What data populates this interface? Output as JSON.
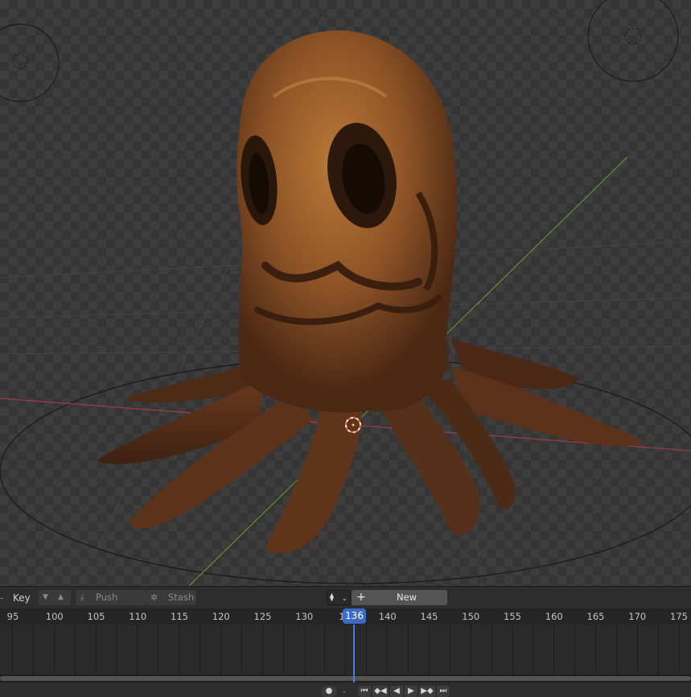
{
  "header": {
    "key_label": "Key",
    "push_down_label": "Push Down",
    "stash_label": "Stash",
    "new_label": "New",
    "plus_symbol": "+"
  },
  "timeline": {
    "current_frame": "136",
    "ticks": [
      "95",
      "100",
      "105",
      "110",
      "115",
      "120",
      "125",
      "130",
      "1",
      "140",
      "145",
      "150",
      "155",
      "160",
      "165",
      "170",
      "175"
    ]
  },
  "colors": {
    "x_axis": "#a23a45",
    "y_axis": "#5f8a30",
    "playhead": "#4a7fd6"
  },
  "icons": {
    "key_down": "triangle-down",
    "key_up": "triangle-up",
    "push_down": "push-down-icon",
    "stash": "gear-icon",
    "action": "action-icon"
  }
}
